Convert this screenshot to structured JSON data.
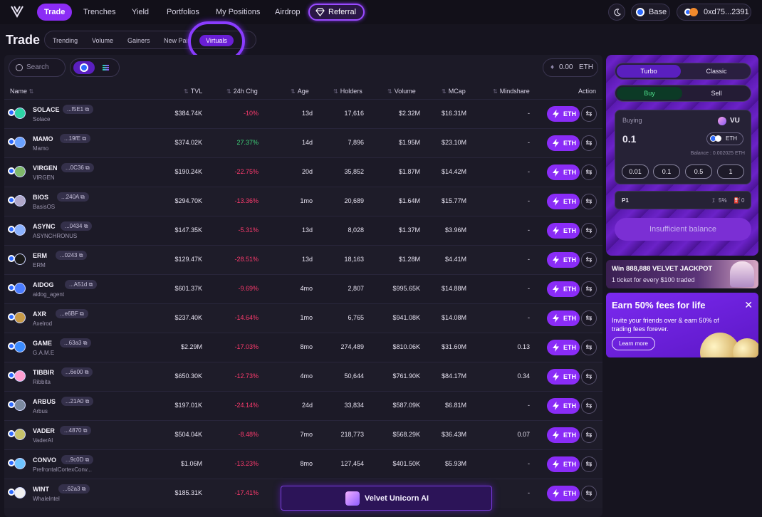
{
  "nav": {
    "items": [
      "Trade",
      "Trenches",
      "Yield",
      "Portfolios",
      "My Positions",
      "Airdrop"
    ],
    "referral": "Referral",
    "network": "Base",
    "wallet": "0xd75...2391"
  },
  "page": {
    "title": "Trade",
    "filters": [
      "Trending",
      "Volume",
      "Gainers",
      "New Pairs",
      "Virtuals"
    ],
    "active_filter": "Virtuals"
  },
  "toolbar": {
    "search_placeholder": "Search",
    "balance_value": "0.00",
    "balance_unit": "ETH"
  },
  "table": {
    "columns": [
      "Name",
      "TVL",
      "24h Chg",
      "Age",
      "Holders",
      "Volume",
      "MCap",
      "Mindshare",
      "Action"
    ],
    "action_label": "ETH",
    "rows": [
      {
        "symbol": "SOLACE",
        "addr": "...f5E1",
        "name": "Solace",
        "tvl": "$384.74K",
        "chg": "-10%",
        "age": "13d",
        "holders": "17,616",
        "volume": "$2.32M",
        "mcap": "$16.31M",
        "mind": "-",
        "dir": "neg"
      },
      {
        "symbol": "MAMO",
        "addr": "...19fE",
        "name": "Mamo",
        "tvl": "$374.02K",
        "chg": "27.37%",
        "age": "14d",
        "holders": "7,896",
        "volume": "$1.95M",
        "mcap": "$23.10M",
        "mind": "-",
        "dir": "pos"
      },
      {
        "symbol": "VIRGEN",
        "addr": "...0C36",
        "name": "VIRGEN",
        "tvl": "$190.24K",
        "chg": "-22.75%",
        "age": "20d",
        "holders": "35,852",
        "volume": "$1.87M",
        "mcap": "$14.42M",
        "mind": "-",
        "dir": "neg"
      },
      {
        "symbol": "BIOS",
        "addr": "...240A",
        "name": "BasisOS",
        "tvl": "$294.70K",
        "chg": "-13.36%",
        "age": "1mo",
        "holders": "20,689",
        "volume": "$1.64M",
        "mcap": "$15.77M",
        "mind": "-",
        "dir": "neg"
      },
      {
        "symbol": "ASYNC",
        "addr": "...0434",
        "name": "ASYNCHRONUS",
        "tvl": "$147.35K",
        "chg": "-5.31%",
        "age": "13d",
        "holders": "8,028",
        "volume": "$1.37M",
        "mcap": "$3.96M",
        "mind": "-",
        "dir": "neg"
      },
      {
        "symbol": "ERM",
        "addr": "...0243",
        "name": "ERM",
        "tvl": "$129.47K",
        "chg": "-28.51%",
        "age": "13d",
        "holders": "18,163",
        "volume": "$1.28M",
        "mcap": "$4.41M",
        "mind": "-",
        "dir": "neg"
      },
      {
        "symbol": "AIDOG",
        "addr": "...A51d",
        "name": "aidog_agent",
        "tvl": "$601.37K",
        "chg": "-9.69%",
        "age": "4mo",
        "holders": "2,807",
        "volume": "$995.65K",
        "mcap": "$14.88M",
        "mind": "-",
        "dir": "neg"
      },
      {
        "symbol": "AXR",
        "addr": "...e6BF",
        "name": "Axelrod",
        "tvl": "$237.40K",
        "chg": "-14.64%",
        "age": "1mo",
        "holders": "6,765",
        "volume": "$941.08K",
        "mcap": "$14.08M",
        "mind": "-",
        "dir": "neg"
      },
      {
        "symbol": "GAME",
        "addr": "...63a3",
        "name": "G.A.M.E",
        "tvl": "$2.29M",
        "chg": "-17.03%",
        "age": "8mo",
        "holders": "274,489",
        "volume": "$810.06K",
        "mcap": "$31.60M",
        "mind": "0.13",
        "dir": "neg"
      },
      {
        "symbol": "TIBBIR",
        "addr": "...6e00",
        "name": "Ribbita",
        "tvl": "$650.30K",
        "chg": "-12.73%",
        "age": "4mo",
        "holders": "50,644",
        "volume": "$761.90K",
        "mcap": "$84.17M",
        "mind": "0.34",
        "dir": "neg"
      },
      {
        "symbol": "ARBUS",
        "addr": "...21A0",
        "name": "Arbus",
        "tvl": "$197.01K",
        "chg": "-24.14%",
        "age": "24d",
        "holders": "33,834",
        "volume": "$587.09K",
        "mcap": "$6.81M",
        "mind": "-",
        "dir": "neg"
      },
      {
        "symbol": "VADER",
        "addr": "...4870",
        "name": "VaderAI",
        "tvl": "$504.04K",
        "chg": "-8.48%",
        "age": "7mo",
        "holders": "218,773",
        "volume": "$568.29K",
        "mcap": "$36.43M",
        "mind": "0.07",
        "dir": "neg"
      },
      {
        "symbol": "CONVO",
        "addr": "...9c0D",
        "name": "PrefrontalCortexConv...",
        "tvl": "$1.06M",
        "chg": "-13.23%",
        "age": "8mo",
        "holders": "127,454",
        "volume": "$401.50K",
        "mcap": "$5.93M",
        "mind": "-",
        "dir": "neg"
      },
      {
        "symbol": "WINT",
        "addr": "...62a3",
        "name": "WhaleIntel",
        "tvl": "$185.31K",
        "chg": "-17.41%",
        "age": "",
        "holders": "",
        "volume": "",
        "mcap": "",
        "mind": "-",
        "dir": "neg"
      }
    ]
  },
  "velvet": {
    "label": "Velvet Unicorn AI"
  },
  "trade_panel": {
    "mode_on": "Turbo",
    "mode_off": "Classic",
    "side_on": "Buy",
    "side_off": "Sell",
    "buying_label": "Buying",
    "token": "VU",
    "amount": "0.1",
    "pay_token": "ETH",
    "balance_text": "Balance : 0.002025 ETH",
    "quick_amounts": [
      "0.01",
      "0.1",
      "0.5",
      "1"
    ],
    "preset": "P1",
    "slippage": "5%",
    "gas": "0",
    "submit_label": "Insufficient balance"
  },
  "promo": {
    "jackpot_title": "Win 888,888 VELVET JACKPOT",
    "jackpot_sub": "1 ticket for every $100 traded",
    "earn_title": "Earn 50% fees for life",
    "earn_body": "Invite your friends over & earn 50% of trading fees forever.",
    "earn_button": "Learn more"
  },
  "colors": {
    "accent": "#8b2cf5",
    "negative": "#ff3b6e",
    "positive": "#3fd67a"
  }
}
